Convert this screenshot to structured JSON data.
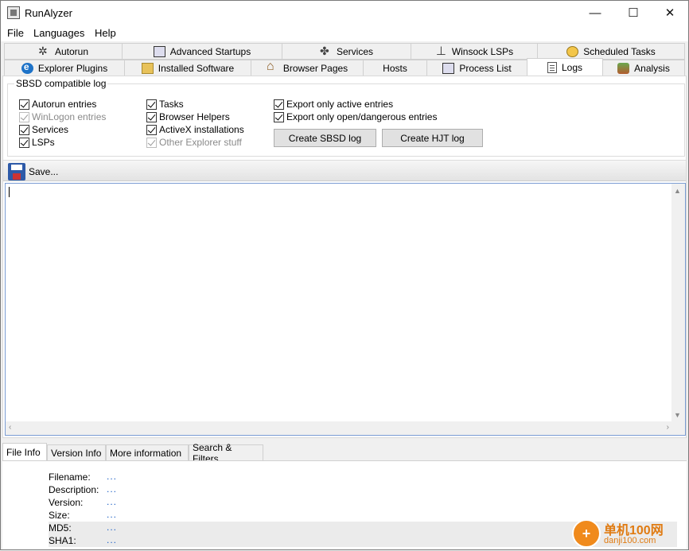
{
  "window": {
    "title": "RunAlyzer"
  },
  "menu": [
    "File",
    "Languages",
    "Help"
  ],
  "tabs_top": [
    {
      "label": "Autorun",
      "icon": "gear-icon"
    },
    {
      "label": "Advanced Startups",
      "icon": "monitor-icon"
    },
    {
      "label": "Services",
      "icon": "puzzle-icon"
    },
    {
      "label": "Winsock LSPs",
      "icon": "network-icon"
    },
    {
      "label": "Scheduled Tasks",
      "icon": "clock-icon"
    }
  ],
  "tabs_bottom": [
    {
      "label": "Explorer Plugins",
      "icon": "ie-icon"
    },
    {
      "label": "Installed Software",
      "icon": "package-icon"
    },
    {
      "label": "Browser Pages",
      "icon": "house-icon"
    },
    {
      "label": "Hosts",
      "icon": ""
    },
    {
      "label": "Process List",
      "icon": "monitor-icon"
    },
    {
      "label": "Logs",
      "icon": "document-icon",
      "active": true
    },
    {
      "label": "Analysis",
      "icon": "bottle-icon"
    }
  ],
  "log_group": {
    "title": "SBSD compatible log",
    "checkboxes": [
      {
        "label": "Autorun entries",
        "checked": true,
        "enabled": true
      },
      {
        "label": "WinLogon entries",
        "checked": true,
        "enabled": false
      },
      {
        "label": "Services",
        "checked": true,
        "enabled": true
      },
      {
        "label": "LSPs",
        "checked": true,
        "enabled": true
      },
      {
        "label": "Tasks",
        "checked": true,
        "enabled": true
      },
      {
        "label": "Browser Helpers",
        "checked": true,
        "enabled": true
      },
      {
        "label": "ActiveX installations",
        "checked": true,
        "enabled": true
      },
      {
        "label": "Other Explorer stuff",
        "checked": true,
        "enabled": false
      },
      {
        "label": "Export only active entries",
        "checked": true,
        "enabled": true
      },
      {
        "label": "Export only open/dangerous entries",
        "checked": true,
        "enabled": true
      }
    ],
    "buttons": {
      "sbsd": "Create SBSD log",
      "hjt": "Create HJT log"
    }
  },
  "save_label": "Save...",
  "log_text": "",
  "bottom_tabs": [
    "File Info",
    "Version Info",
    "More information",
    "Search & Filters"
  ],
  "file_info": [
    {
      "key": "Filename:",
      "value": "..."
    },
    {
      "key": "Description:",
      "value": "..."
    },
    {
      "key": "Version:",
      "value": "..."
    },
    {
      "key": "Size:",
      "value": "..."
    },
    {
      "key": "MD5:",
      "value": "..."
    },
    {
      "key": "SHA1:",
      "value": "..."
    }
  ],
  "watermark": {
    "text": "单机100网",
    "url": "danji100.com"
  },
  "colors": {
    "link_blue": "#1a5ec4",
    "watermark_orange": "#e07b12",
    "textarea_border": "#7a9cd3"
  }
}
